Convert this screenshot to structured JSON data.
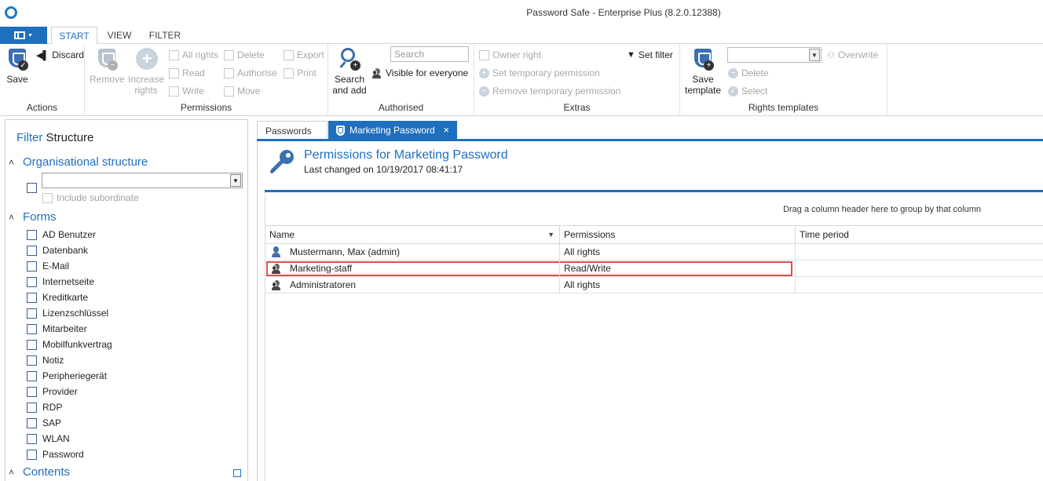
{
  "window": {
    "title": "Password Safe - Enterprise Plus (8.2.0.12388)"
  },
  "ribbon_tabs": [
    "START",
    "VIEW",
    "FILTER"
  ],
  "ribbon": {
    "actions": {
      "save_label": "Save",
      "discard_label": "Discard",
      "group_label": "Actions"
    },
    "permissions": {
      "remove_label": "Remove",
      "increase_label_1": "Increase",
      "increase_label_2": "rights",
      "checkboxes": [
        "All rights",
        "Delete",
        "Export",
        "Read",
        "Authorise",
        "Print",
        "Write",
        "Move"
      ],
      "group_label": "Permissions"
    },
    "authorised": {
      "search_placeholder": "Search",
      "search_and_add_1": "Search",
      "search_and_add_2": "and add",
      "visible_for_everyone": "Visible for everyone",
      "group_label": "Authorised"
    },
    "extras": {
      "owner_right": "Owner right",
      "set_temporary_permission": "Set temporary permission",
      "remove_temporary_permission": "Remove temporary permission",
      "set_filter": "Set filter",
      "group_label": "Extras"
    },
    "rights_templates": {
      "save_template_1": "Save",
      "save_template_2": "template",
      "overwrite": "Overwrite",
      "delete": "Delete",
      "select": "Select",
      "group_label": "Rights templates"
    }
  },
  "filter_pane": {
    "title_filter": "Filter",
    "title_structure": "Structure",
    "org_section": "Organisational structure",
    "include_subordinate": "Include subordinate",
    "forms_section": "Forms",
    "forms": [
      "AD Benutzer",
      "Datenbank",
      "E-Mail",
      "Internetseite",
      "Kreditkarte",
      "Lizenzschlüssel",
      "Mitarbeiter",
      "Mobilfunkvertrag",
      "Notiz",
      "Peripheriegerät",
      "Provider",
      "RDP",
      "SAP",
      "WLAN",
      "Password"
    ],
    "contents_section": "Contents"
  },
  "doc_tabs": {
    "passwords": "Passwords",
    "marketing_password": "Marketing Password",
    "close_glyph": "×"
  },
  "main": {
    "title": "Permissions for Marketing Password",
    "last_changed": "Last changed on 10/19/2017 08:41:17",
    "group_hint": "Drag a column header here to group by that column",
    "columns": [
      "Name",
      "Permissions",
      "Time period"
    ],
    "rows": [
      {
        "name": "Mustermann, Max (admin)",
        "permissions": "All rights",
        "time_period": "",
        "icon": "user-icon"
      },
      {
        "name": "Marketing-staff",
        "permissions": "Read/Write",
        "time_period": "",
        "icon": "group-icon",
        "highlighted": true
      },
      {
        "name": "Administratoren",
        "permissions": "All rights",
        "time_period": "",
        "icon": "group-icon"
      }
    ]
  },
  "colors": {
    "accent": "#1f6fbf",
    "highlight_border": "#d9534f",
    "disabled_text": "#a8a8a8"
  }
}
